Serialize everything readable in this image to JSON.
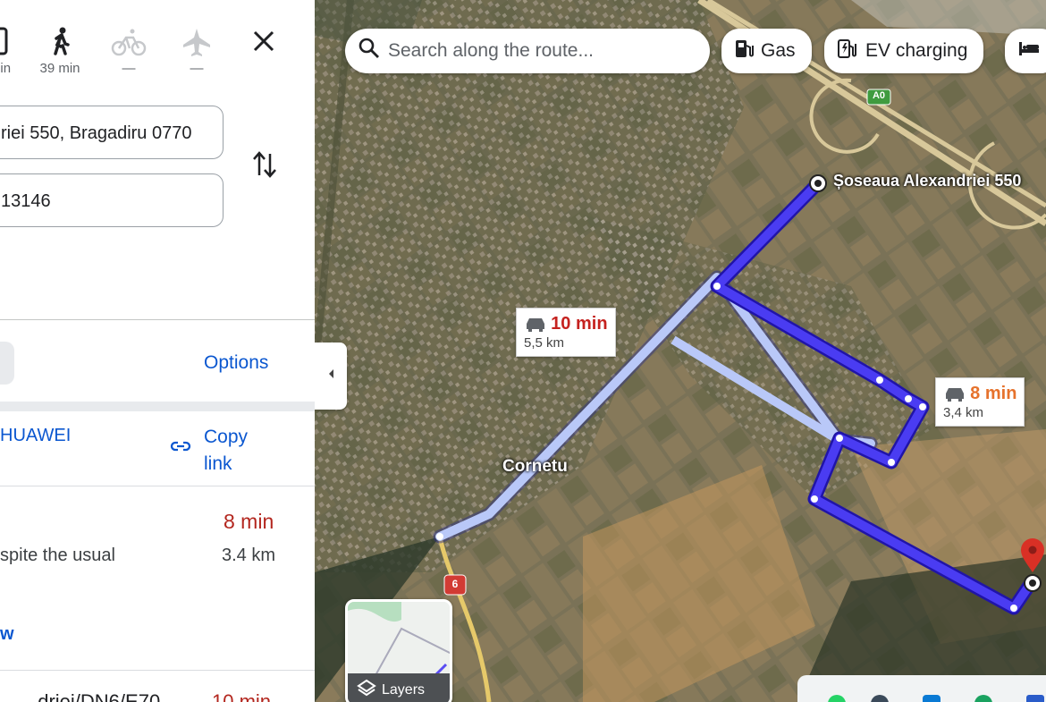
{
  "modes": [
    {
      "name": "drive",
      "time": "min"
    },
    {
      "name": "walk",
      "time": "39 min"
    },
    {
      "name": "bike",
      "time": "—"
    },
    {
      "name": "flight",
      "time": "—"
    }
  ],
  "origin": "riei 550, Bragadiru 0770",
  "destination": "13146",
  "options_label": "Options",
  "share": {
    "device": "HUAWEI",
    "copy_link": "Copy\nlink"
  },
  "route1": {
    "time": "8 min",
    "note": "spite the usual",
    "distance": "3.4 km",
    "link": "w"
  },
  "route2_partial": "..driei/DN6/E70",
  "route2_time": "10 min",
  "search_placeholder": "Search along the route...",
  "chips": [
    {
      "label": "Gas",
      "icon": "gas-icon"
    },
    {
      "label": "EV charging",
      "icon": "ev-charging-icon"
    }
  ],
  "map": {
    "origin_label": "Șoseaua Alexandriei 550",
    "town_label": "Cornetu",
    "road_a0": "A0",
    "road_6": "6",
    "tip_alt": {
      "time": "10 min",
      "distance": "5,5 km"
    },
    "tip_main": {
      "time": "8 min",
      "distance": "3,4 km"
    },
    "layers_label": "Layers",
    "colors": {
      "route": "#4a3cf2",
      "route_alt": "#b9c8f8",
      "traffic_warn": "#e6722c"
    }
  }
}
